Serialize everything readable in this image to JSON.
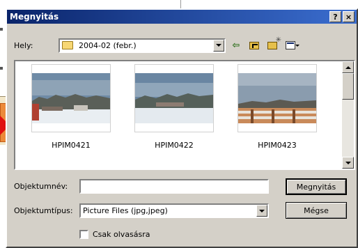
{
  "window": {
    "title": "Megnyitás",
    "help_label": "?",
    "close_label": "×"
  },
  "location": {
    "label": "Hely:",
    "value": "2004-02 (febr.)"
  },
  "files": [
    {
      "name": "HPIM0421"
    },
    {
      "name": "HPIM0422"
    },
    {
      "name": "HPIM0423"
    }
  ],
  "filename": {
    "label": "Objektumnév:",
    "value": ""
  },
  "filetype": {
    "label": "Objektumtípus:",
    "value": "Picture Files (jpg,jpeg)"
  },
  "buttons": {
    "open_label": "Megnyitás",
    "cancel_label": "Mégse"
  },
  "readonly": {
    "label": "Csak olvasásra",
    "checked": false
  },
  "toolbar": {
    "back_glyph": "⇦"
  },
  "colors": {
    "titlebar": "#0a246a",
    "face": "#d4d0c8"
  }
}
